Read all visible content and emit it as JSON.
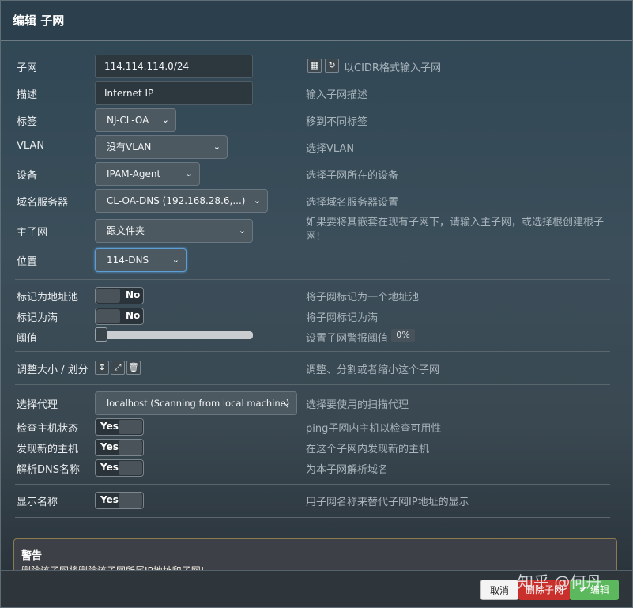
{
  "dialog": {
    "title": "编辑 子网"
  },
  "fields": {
    "subnet": {
      "label": "子网",
      "value": "114.114.114.0/24",
      "help": "以CIDR格式输入子网"
    },
    "description": {
      "label": "描述",
      "value": "Internet IP",
      "help": "输入子网描述"
    },
    "tag": {
      "label": "标签",
      "value": "NJ-CL-OA",
      "help": "移到不同标签"
    },
    "vlan": {
      "label": "VLAN",
      "value": "没有VLAN",
      "help": "选择VLAN"
    },
    "device": {
      "label": "设备",
      "value": "IPAM-Agent",
      "help": "选择子网所在的设备"
    },
    "nameserver": {
      "label": "域名服务器",
      "value": "CL-OA-DNS (192.168.28.6,...)",
      "help": "选择域名服务器设置"
    },
    "master_subnet": {
      "label": "主子网",
      "value": "跟文件夹",
      "help": "如果要将其嵌套在现有子网下，请输入主子网，或选择根创建根子网!"
    },
    "location": {
      "label": "位置",
      "value": "114-DNS"
    },
    "is_pool": {
      "label": "标记为地址池",
      "value": "No",
      "help": "将子网标记为一个地址池"
    },
    "is_full": {
      "label": "标记为满",
      "value": "No",
      "help": "将子网标记为满"
    },
    "threshold": {
      "label": "阈值",
      "value": "0%",
      "level": 0,
      "help": "设置子网警报阈值"
    },
    "resize": {
      "label": "调整大小 / 划分",
      "help": "调整、分割或者缩小这个子网"
    },
    "scan_agent": {
      "label": "选择代理",
      "value": "localhost (Scanning from local machine)",
      "help": "选择要使用的扫描代理"
    },
    "ping_check": {
      "label": "检查主机状态",
      "value": "Yes",
      "help": "ping子网内主机以检查可用性"
    },
    "discover": {
      "label": "发现新的主机",
      "value": "Yes",
      "help": "在这个子网内发现新的主机"
    },
    "resolve_dns": {
      "label": "解析DNS名称",
      "value": "Yes",
      "help": "为本子网解析域名"
    },
    "show_name": {
      "label": "显示名称",
      "value": "Yes",
      "help": "用子网名称来替代子网IP地址的显示"
    }
  },
  "warning": {
    "title": "警告",
    "body": "删除该子网将删除该子网所属IP地址和子网!"
  },
  "buttons": {
    "cancel": "取消",
    "delete": "删除子网",
    "edit": "编辑"
  },
  "watermark": "知乎 @何丹",
  "icons": {
    "subnet_tools": [
      "grid-icon",
      "refresh-icon"
    ],
    "resize_tools": [
      "resize-vertical-icon",
      "expand-icon",
      "trash-icon"
    ]
  },
  "colors": {
    "delete": "#c9302c",
    "edit": "#5cb85c",
    "focus": "#5e9ed6"
  }
}
